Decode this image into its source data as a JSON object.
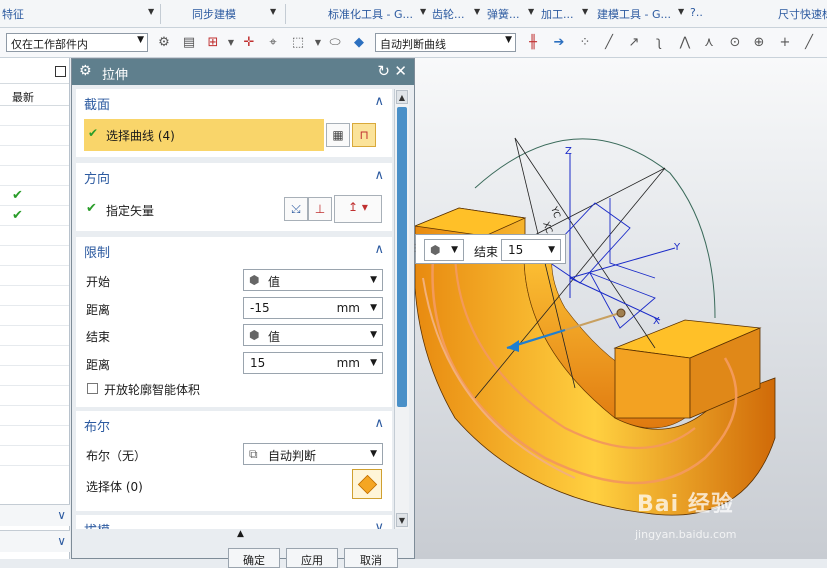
{
  "ribbon": {
    "groups": [
      "特征",
      "同步建模",
      "标准化工具 - G...",
      "齿轮...",
      "弹簧...",
      "加工...",
      "建模工具 - G...",
      "尺寸快速标"
    ]
  },
  "toolbar": {
    "filter_value": "仅在工作部件内",
    "curve_rule_value": "自动判断曲线"
  },
  "left_panel": {
    "column_header": "最新",
    "checkmarks": [
      "✔",
      "✔"
    ]
  },
  "dialog": {
    "title": "拉伸",
    "section": {
      "title": "截面",
      "select_curve_label": "选择曲线 (4)"
    },
    "direction": {
      "title": "方向",
      "vector_label": "指定矢量"
    },
    "limits": {
      "title": "限制",
      "start_label": "开始",
      "start_type": "值",
      "start_distance_label": "距离",
      "start_distance": "-15",
      "start_unit": "mm",
      "end_label": "结束",
      "end_type": "值",
      "end_distance_label": "距离",
      "end_distance": "15",
      "end_unit": "mm",
      "open_profile_label": "开放轮廓智能体积"
    },
    "boolean": {
      "title": "布尔",
      "boolean_label": "布尔（无）",
      "boolean_value": "自动判断",
      "select_body_label": "选择体 (0)"
    },
    "draft": {
      "title": "拔模"
    },
    "buttons": {
      "ok": "确定",
      "apply": "应用",
      "cancel": "取消"
    }
  },
  "viewport": {
    "handle_label": "结束",
    "handle_value": "15",
    "axis_z": "Z",
    "axis_y": "Y",
    "axis_x": "X",
    "dim_a": "XC",
    "dim_b": "YC",
    "dim_c": "ZC",
    "watermark_logo": "Bai 经验",
    "watermark_url": "jingyan.baidu.com"
  },
  "colors": {
    "accent": "#2c5aa0",
    "dialog_title_bg": "#5f7f8d",
    "selection_highlight": "#f9d56a",
    "part_orange": "#f5a623",
    "check_green": "#2a9d2a"
  }
}
